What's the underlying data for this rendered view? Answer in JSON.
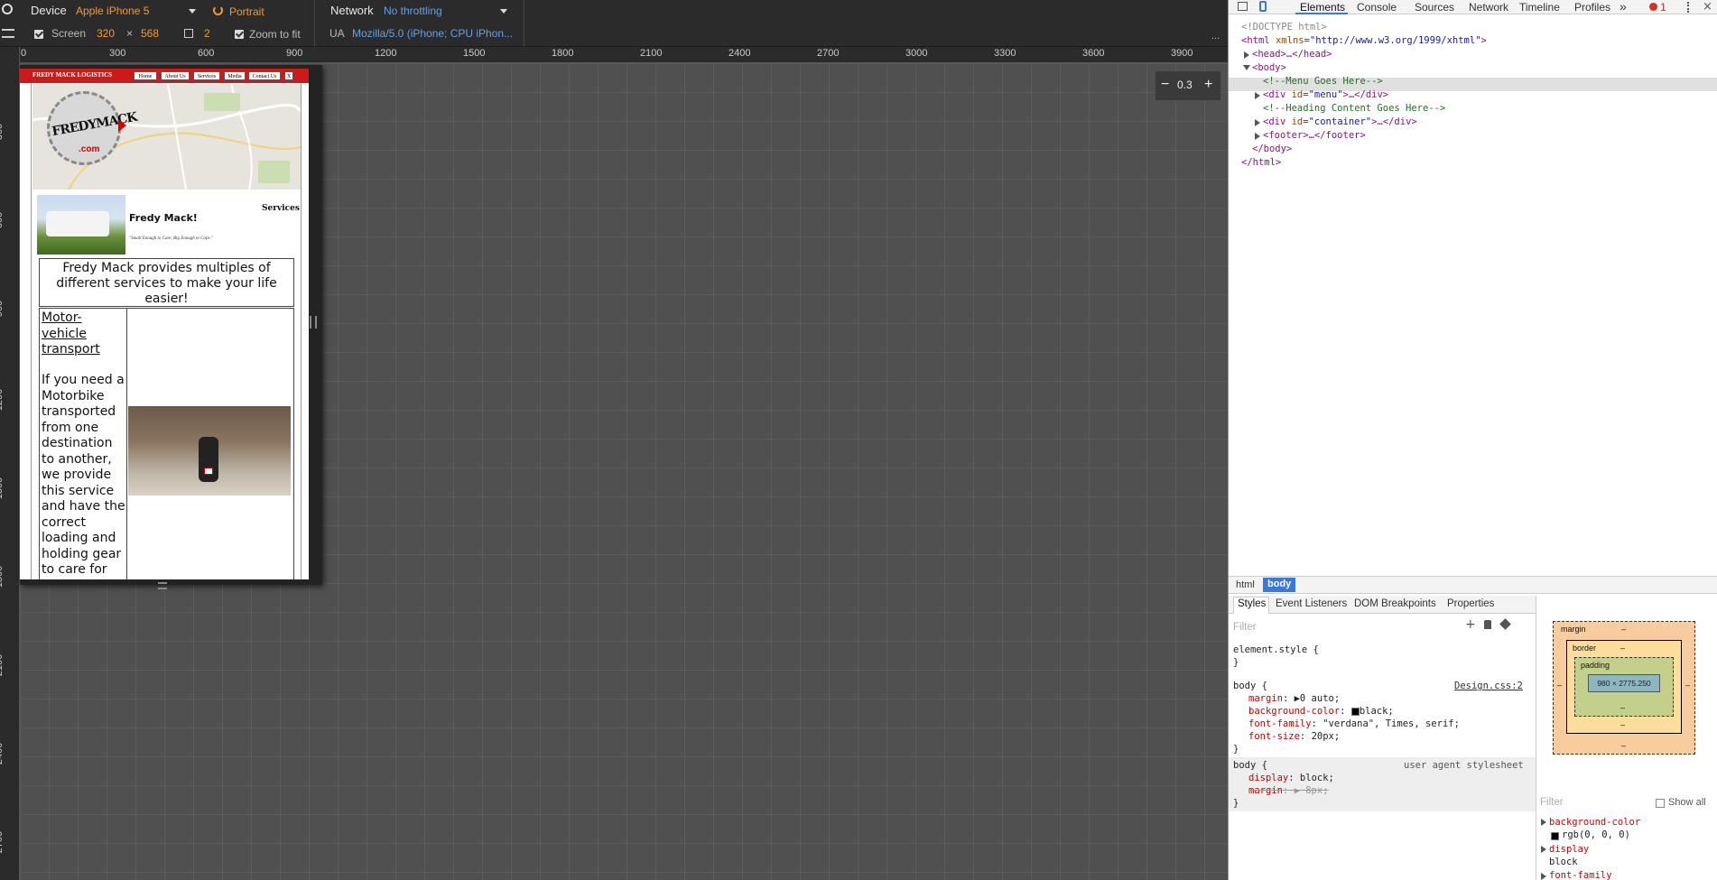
{
  "emulation": {
    "device_label": "Device",
    "device_value": "Apple iPhone 5",
    "orientation": "Portrait",
    "network_label": "Network",
    "network_value": "No throttling",
    "screen_label": "Screen",
    "screen_width": "320",
    "screen_times": "×",
    "screen_height": "568",
    "dpr": "2",
    "zoom_to_fit_label": "Zoom to fit",
    "ua_label": "UA",
    "ua_value": "Mozilla/5.0 (iPhone; CPU iPhon...",
    "more": "..."
  },
  "ruler": {
    "top_ticks": [
      "0",
      "300",
      "600",
      "900",
      "1200",
      "1500",
      "1800",
      "2100",
      "2400",
      "2700",
      "3000",
      "3300",
      "3600",
      "3900"
    ],
    "left_ticks": [
      "300",
      "600",
      "900",
      "1200",
      "1500",
      "1800",
      "2100",
      "2400",
      "2700"
    ]
  },
  "zoom": {
    "minus": "−",
    "value": "0.3",
    "plus": "+"
  },
  "site": {
    "brand": "FREDY MACK LOGISTICS",
    "nav": [
      "Home",
      "About Us",
      "Services",
      "Media",
      "Contact Us"
    ],
    "nav_close": "X",
    "logo_text": "FREDYMACK",
    "logo_sub": ".com",
    "title": "Fredy Mack!",
    "services_title": "Services",
    "tagline": "\"Small Enough to Care, Big Enough to Cope.\"",
    "intro": "Fredy Mack provides multiples of different services to make your life easier!",
    "service_link": "Motor-vehicle transport",
    "service_desc": "If you need a Motorbike transported from one destination to another, we provide this service and have the correct loading and holding gear to care for your vehicle."
  },
  "devtools": {
    "tabs": [
      "Elements",
      "Console",
      "Sources",
      "Network",
      "Timeline",
      "Profiles"
    ],
    "more_tabs": "»",
    "error_count": "1",
    "dom": {
      "doctype": "<!DOCTYPE html>",
      "html_open_tag": "<html ",
      "html_attr": "xmlns",
      "html_val": "\"http://www.w3.org/1999/xhtml\"",
      "head": "<head>…</head>",
      "body_open": "<body>",
      "comment_menu": "<!--Menu Goes Here-->",
      "div_menu_open": "<div ",
      "div_menu_attr": "id",
      "div_menu_val": "\"menu\"",
      "div_menu_close": ">…</div>",
      "comment_heading": "<!--Heading Content Goes Here-->",
      "div_container_open": "<div ",
      "div_container_attr": "id",
      "div_container_val": "\"container\"",
      "div_container_close": ">…</div>",
      "footer": "<footer>…</footer>",
      "body_close": "</body>",
      "html_close": "</html>"
    },
    "breadcrumbs": [
      "html",
      "body"
    ],
    "subtabs": [
      "Styles",
      "Event Listeners",
      "DOM Breakpoints",
      "Properties"
    ],
    "styles_filter_placeholder": "Filter",
    "styles": {
      "element_style": "element.style {",
      "close_brace": "}",
      "body_rule_selector": "body {",
      "body_rule_source": "Design.css:2",
      "margin_prop": "margin",
      "margin_val": "▶0 auto;",
      "bg_prop": "background-color",
      "bg_val": "black;",
      "font_family_prop": "font-family",
      "font_family_val": "\"verdana\", Times, serif;",
      "font_size_prop": "font-size",
      "font_size_val": "20px;",
      "ua_selector": "body {",
      "ua_source": "user agent stylesheet",
      "display_prop": "display",
      "display_val": "block;",
      "ua_margin_prop": "margin",
      "ua_margin_val": "▶ 8px;"
    },
    "metrics": {
      "margin_label": "margin",
      "border_label": "border",
      "padding_label": "padding",
      "dash": "–",
      "content_size": "980 × 2775.250",
      "filter_placeholder": "Filter",
      "show_all": "Show all",
      "computed": [
        {
          "name": "background-color",
          "value": "rgb(0, 0, 0)"
        },
        {
          "name": "display",
          "value": "block"
        },
        {
          "name": "font-family",
          "value": ""
        }
      ]
    }
  },
  "colors": {
    "canvas_bg": "#505050",
    "accent_orange": "#f29b2e",
    "accent_blue": "#3879d9",
    "site_red": "#cc1a1a"
  }
}
